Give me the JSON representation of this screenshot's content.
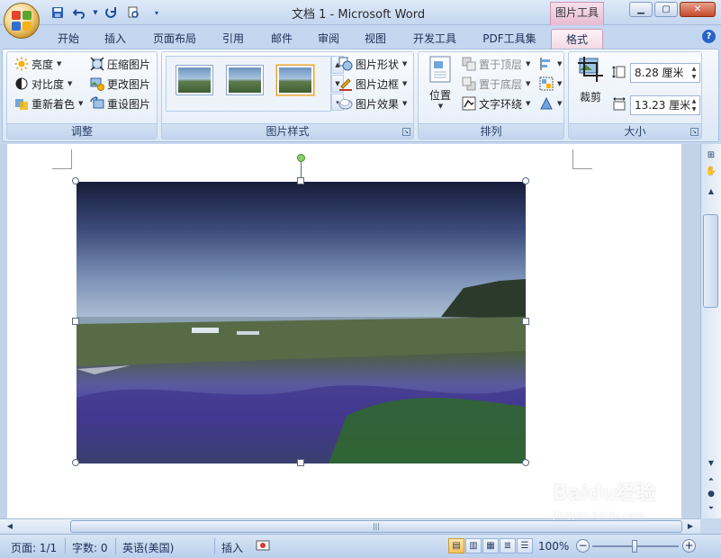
{
  "window": {
    "title": "文档 1 - Microsoft Word",
    "context_tab_title": "图片工具",
    "controls": [
      "minimize",
      "maximize",
      "close"
    ]
  },
  "quick_access": {
    "icons": [
      "save-icon",
      "undo-icon",
      "redo-icon",
      "print-preview-icon",
      "customize-icon"
    ]
  },
  "tabs": [
    {
      "label": "开始"
    },
    {
      "label": "插入"
    },
    {
      "label": "页面布局"
    },
    {
      "label": "引用"
    },
    {
      "label": "邮件"
    },
    {
      "label": "审阅"
    },
    {
      "label": "视图"
    },
    {
      "label": "开发工具"
    },
    {
      "label": "PDF工具集"
    },
    {
      "label": "格式",
      "active": true
    }
  ],
  "ribbon": {
    "adjust": {
      "label": "调整",
      "brightness": "亮度",
      "contrast": "对比度",
      "recolor": "重新着色",
      "compress": "压缩图片",
      "change_picture": "更改图片",
      "reset_picture": "重设图片"
    },
    "picture_styles": {
      "label": "图片样式",
      "shape": "图片形状",
      "border": "图片边框",
      "effects": "图片效果"
    },
    "arrange": {
      "label": "排列",
      "position": "位置",
      "bring_front": "置于顶层",
      "send_back": "置于底层",
      "text_wrap": "文字环绕"
    },
    "size": {
      "label": "大小",
      "crop": "裁剪",
      "height": "8.28 厘米",
      "width": "13.23 厘米"
    }
  },
  "statusbar": {
    "page": "页面: 1/1",
    "words": "字数: 0",
    "language": "英语(美国)",
    "mode": "插入",
    "zoom": "100%",
    "zoom_level": 1.0
  },
  "watermark": {
    "brand": "Baidu经验",
    "url": "jingyan.baidu.com"
  },
  "colors": {
    "accent_context": "#d497b5",
    "ribbon_blue": "#c4d7f0"
  }
}
